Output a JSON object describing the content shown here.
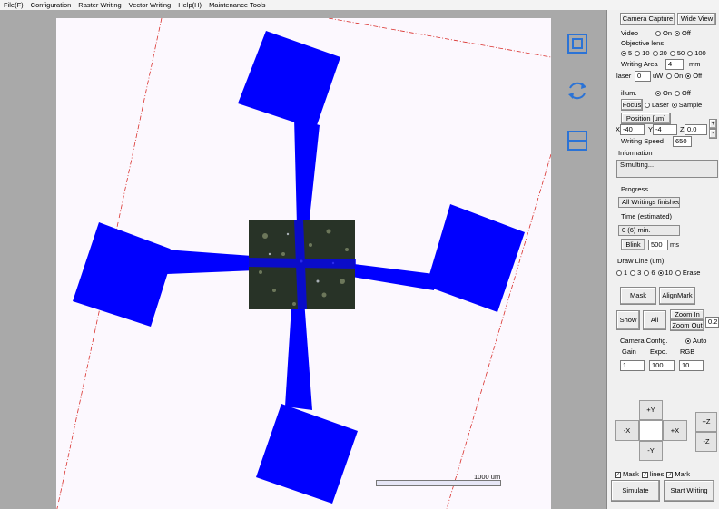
{
  "menu": [
    "File(F)",
    "Configuration",
    "Raster Writing",
    "Vector Writing",
    "Help(H)",
    "Maintenance Tools"
  ],
  "canvas": {
    "icons": [
      "fit-view-icon",
      "rotate-icon",
      "split-view-icon"
    ],
    "scale_label": "1000 um",
    "pattern_color": "#0000ff",
    "border_color": "#d9302c",
    "background": "#fcf8fe"
  },
  "panel": {
    "camera_capture": "Camera Capture",
    "wide_view": "Wide View",
    "video_label": "Video",
    "video_on": "On",
    "video_off": "Off",
    "objective_label": "Objective lens",
    "objective_options": [
      "5",
      "10",
      "20",
      "50",
      "100"
    ],
    "objective_selected": "5",
    "writing_area_label": "Writing Area",
    "writing_area_value": "4",
    "writing_area_unit": "mm",
    "laser_label": "laser",
    "laser_value": "0",
    "laser_unit": "uW",
    "laser_on": "On",
    "laser_off": "Off",
    "illum_label": "illum.",
    "illum_on": "On",
    "illum_off": "Off",
    "focus_label": "Focus",
    "focus_laser": "Laser",
    "focus_sample": "Sample",
    "position_label": "Position [um]",
    "x_label": "X",
    "x_value": "-40",
    "y_label": "Y",
    "y_value": "-4",
    "z_label": "Z",
    "z_value": "0.0",
    "stepper_plus": "+",
    "stepper_minus": "-",
    "writing_speed_label": "Writing Speed",
    "writing_speed_value": "650",
    "information_label": "Information",
    "information_value": "Simulting...",
    "progress_label": "Progress",
    "progress_value": "All Writings finished",
    "time_label": "Time (estimated)",
    "time_value": "0 (6) min.",
    "blink_label": "Blink",
    "blink_value": "500",
    "blink_unit": "ms",
    "draw_line_label": "Draw Line (um)",
    "draw_line_options": [
      "1",
      "3",
      "6",
      "10"
    ],
    "draw_line_selected": "10",
    "erase_label": "Erase",
    "mask_button": "Mask",
    "alignmark_button": "AlignMark",
    "show_button": "Show",
    "all_button": "All",
    "zoom_in_button": "Zoom In",
    "zoom_out_button": "Zoom Out",
    "zoom_value": "0.2",
    "camera_config_label": "Camera Config.",
    "auto_label": "Auto",
    "gain_label": "Gain",
    "expo_label": "Expo.",
    "rgb_label": "RGB",
    "gain_value": "1",
    "expo_value": "100",
    "rgb_value": "10",
    "dpad": {
      "up": "+Y",
      "down": "-Y",
      "left": "-X",
      "right": "+X",
      "z_up": "+Z",
      "z_down": "-Z"
    },
    "check_mask": "Mask",
    "check_lines": "lines",
    "check_mark": "Mark",
    "simulate_button": "Simulate",
    "start_writing_button": "Start Writing"
  }
}
